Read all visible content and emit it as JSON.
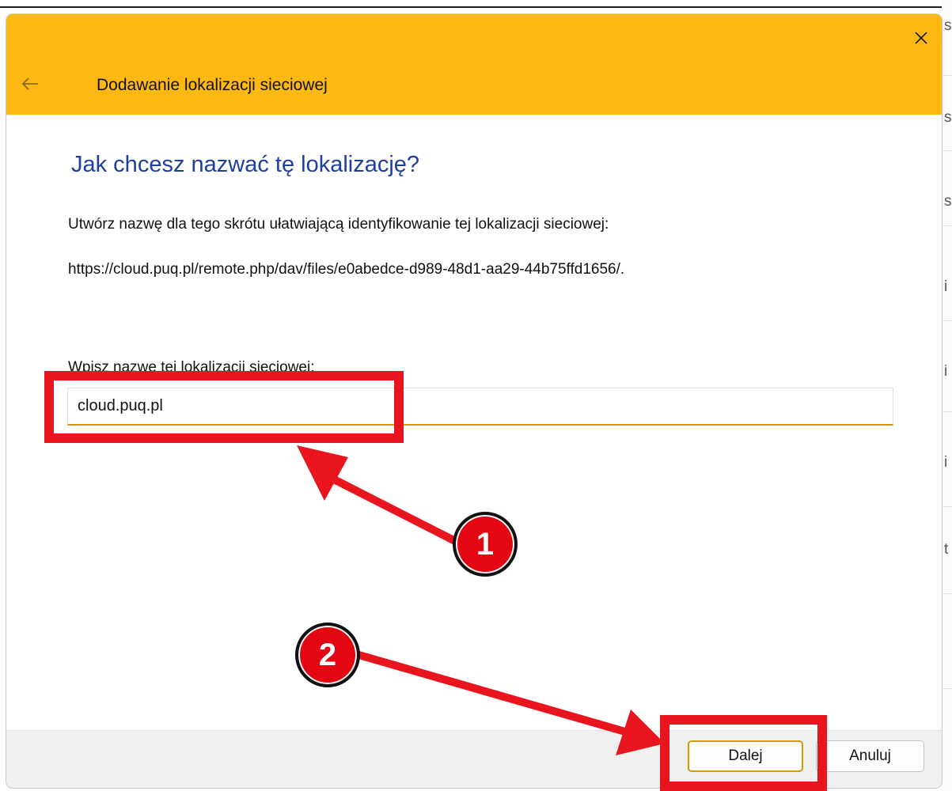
{
  "dialog": {
    "title": "Dodawanie lokalizacji sieciowej",
    "heading": "Jak chcesz nazwać tę lokalizację?",
    "description": "Utwórz nazwę dla tego skrótu ułatwiającą identyfikowanie tej lokalizacji sieciowej:",
    "url": "https://cloud.puq.pl/remote.php/dav/files/e0abedce-d989-48d1-aa29-44b75ffd1656/.",
    "name_label": "Wpisz nazwę tej lokalizacji sieciowej:",
    "name_value": "cloud.puq.pl",
    "next_button": "Dalej",
    "cancel_button": "Anuluj",
    "close_icon": "close-icon",
    "back_icon": "back-arrow-icon"
  },
  "annotations": {
    "step1": "1",
    "step2": "2"
  },
  "background_window": {
    "chars": [
      "s",
      "s",
      "s",
      "i",
      "i",
      "i",
      "t"
    ]
  },
  "colors": {
    "header": "#FDB813",
    "heading_text": "#1f3f9f",
    "annotation_red": "#E8141E",
    "input_accent": "#D89A00"
  }
}
